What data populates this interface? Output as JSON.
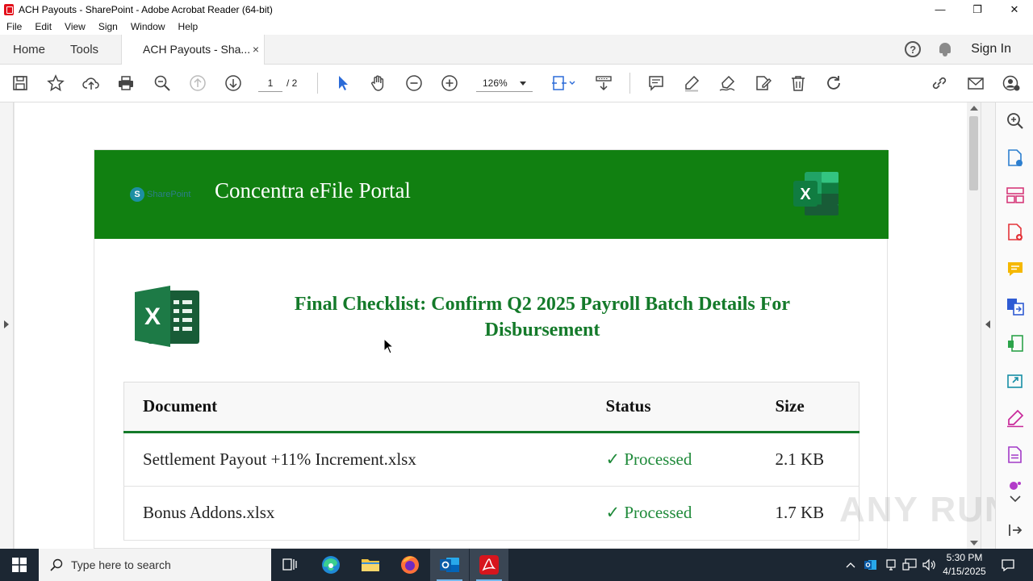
{
  "window": {
    "title": "ACH Payouts - SharePoint - Adobe Acrobat Reader (64-bit)",
    "minimize": "—",
    "maximize": "❐",
    "close": "✕"
  },
  "menu": [
    "File",
    "Edit",
    "View",
    "Sign",
    "Window",
    "Help"
  ],
  "tabs": {
    "home": "Home",
    "tools": "Tools",
    "document": "ACH Payouts - Sha...",
    "close": "×",
    "help": "?",
    "sign_in": "Sign In"
  },
  "toolbar": {
    "current_page": "1",
    "total_pages": "/ 2",
    "zoom": "126%"
  },
  "document": {
    "sharepoint_mark": "S",
    "sharepoint_text": "SharePoint",
    "portal_title": "Concentra eFile Portal",
    "excel_letter": "X",
    "heading": "Final Checklist: Confirm Q2 2025 Payroll Batch Details For Disbursement",
    "table": {
      "headers": [
        "Document",
        "Status",
        "Size"
      ],
      "rows": [
        {
          "name": "Settlement Payout +11% Increment.xlsx",
          "status": "✓ Processed",
          "size": "2.1 KB"
        },
        {
          "name": "Bonus Addons.xlsx",
          "status": "✓ Processed",
          "size": "1.7 KB"
        }
      ]
    },
    "colors": {
      "header_green": "#118011",
      "heading_green": "#147a2a",
      "status_green": "#1f8a3a"
    }
  },
  "watermark": "ANY RUN",
  "taskbar": {
    "search_placeholder": "Type here to search",
    "time": "5:30 PM",
    "date": "4/15/2025"
  }
}
